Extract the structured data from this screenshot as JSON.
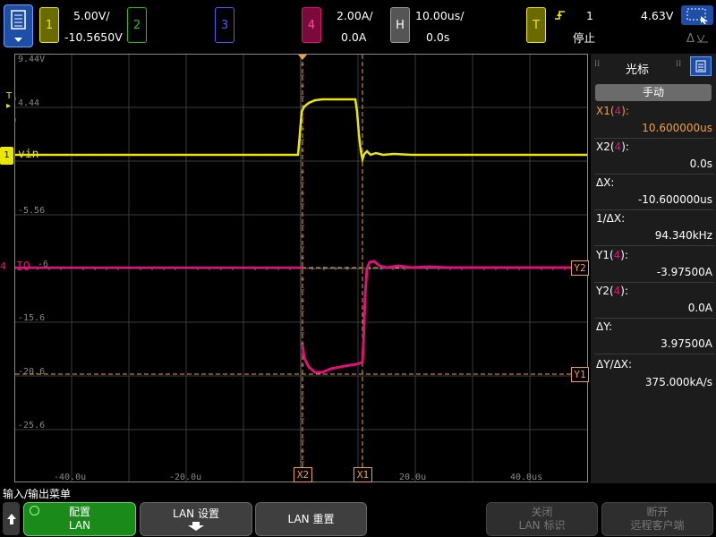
{
  "colors": {
    "ch1": "#e8e800",
    "ch2": "#22c022",
    "ch3": "#4a5cff",
    "ch4": "#e0107a",
    "cursor": "#f0a040",
    "accent": "#3aa0ff"
  },
  "topbar": {
    "ch1": {
      "num": "1",
      "scale": "5.00V/",
      "offset": "-10.5650V"
    },
    "ch2": {
      "num": "2"
    },
    "ch3": {
      "num": "3"
    },
    "ch4": {
      "num": "4",
      "scale": "2.00A/",
      "offset": "0.0A"
    },
    "horiz": {
      "label": "H",
      "scale": "10.00us/",
      "delay": "0.0s"
    },
    "trigger": {
      "label": "T",
      "source": "1",
      "level": "4.63V",
      "status": "停止"
    }
  },
  "plot": {
    "y_labels": [
      "9.44V",
      "4.44",
      "-5.56",
      "-6",
      "-15.6",
      "-20.6",
      "-25.6"
    ],
    "x_labels": [
      "-40.0u",
      "-20.0u",
      "20.0u",
      "40.0us"
    ],
    "ch1_label": "vin",
    "ch4_label": "IO",
    "cursor_labels": {
      "x1": "X1",
      "x2": "X2",
      "y1": "Y1",
      "y2": "Y2"
    }
  },
  "sidebar": {
    "title": "光标",
    "mode_button": "手动",
    "rows": [
      {
        "label": "X1(4):",
        "value": "10.600000us"
      },
      {
        "label": "X2(4):",
        "value": "0.0s"
      },
      {
        "label": "ΔX:",
        "value": "-10.600000us"
      },
      {
        "label": "1/ΔX:",
        "value": "94.340kHz"
      },
      {
        "label": "Y1(4):",
        "value": "-3.97500A"
      },
      {
        "label": "Y2(4):",
        "value": "0.0A"
      },
      {
        "label": "ΔY:",
        "value": "3.97500A"
      },
      {
        "label": "ΔY/ΔX:",
        "value": "375.000kA/s"
      }
    ]
  },
  "bottom": {
    "menu_title": "输入/输出菜单",
    "keys": [
      {
        "line1": "配置",
        "line2": "LAN"
      },
      {
        "line1": "LAN 设置",
        "line2": ""
      },
      {
        "line1": "LAN 重置",
        "line2": ""
      },
      {
        "line1": "关闭",
        "line2": "LAN 标识"
      },
      {
        "line1": "断开",
        "line2": "远程客户端"
      }
    ]
  }
}
